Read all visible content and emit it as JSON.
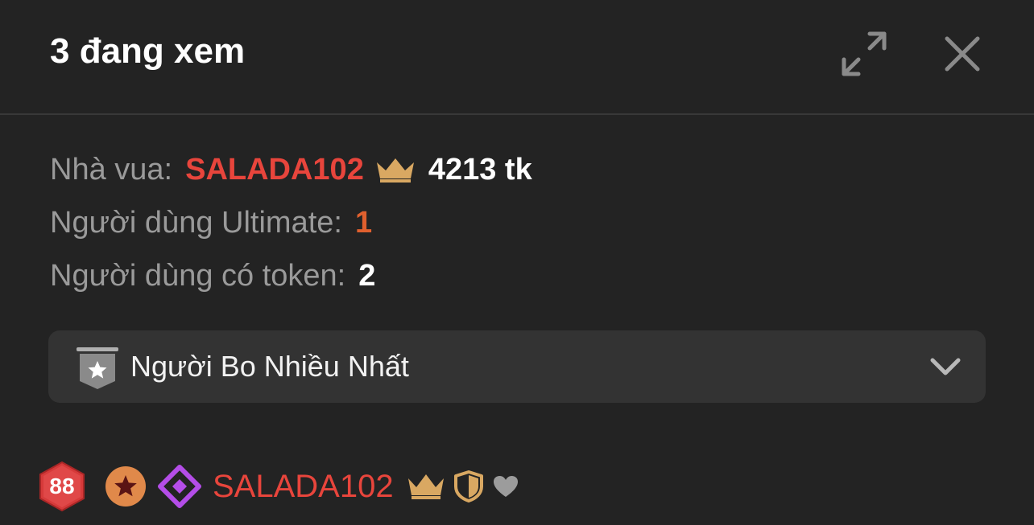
{
  "header": {
    "title": "3 đang xem",
    "expand_icon": "expand-icon",
    "close_icon": "close-icon"
  },
  "stats": {
    "king_label": "Nhà vua:",
    "king_name": "SALADA102",
    "king_tokens": "4213 tk",
    "ultimate_label": "Người dùng Ultimate:",
    "ultimate_value": "1",
    "token_users_label": "Người dùng có token:",
    "token_users_value": "2"
  },
  "dropdown": {
    "selected": "Người Bo Nhiều Nhất",
    "badge_icon": "star-shield-icon",
    "chevron_icon": "chevron-down-icon"
  },
  "user_entry": {
    "level": "88",
    "name": "SALADA102",
    "icons": [
      "star-medal-icon",
      "diamond-icon",
      "crown-icon",
      "shield-icon",
      "heart-icon"
    ]
  },
  "colors": {
    "background": "#232323",
    "king_red": "#e8453c",
    "ultimate_orange": "#e0602e",
    "crown_gold": "#d9a862",
    "diamond_purple": "#b44de8",
    "dropdown_bg": "#333333"
  }
}
